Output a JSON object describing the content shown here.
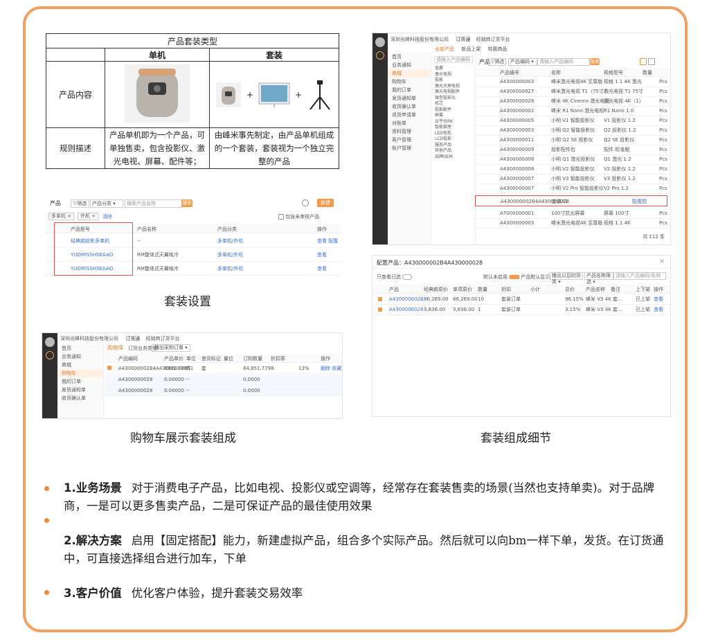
{
  "table": {
    "title": "产品套装类型",
    "col_single": "单机",
    "col_bundle": "套装",
    "row_content": "产品内容",
    "row_rule": "规则描述",
    "rule_single": "产品单机即为一个产品，可单独售卖，包含投影仪、激光电视、屏幕、配件等；",
    "rule_bundle": "由峰米事先制定，由产品单机组成的一个套装，套装视为一个独立完整的产品",
    "plus": "+"
  },
  "suite_setting": {
    "caption": "套装设置",
    "title": "产品",
    "filter": "筛选",
    "select": "产品分类",
    "search_placeholder": "搜索产品名称",
    "search_btn": "搜索",
    "create_btn": "新建",
    "tag_single": "多单机",
    "tag_outer": "外机",
    "clear": "清除",
    "check_label": "包含未审核产品",
    "headers": [
      "产品型号",
      "产品名称",
      "产品分类",
      "操作"
    ],
    "rows": [
      {
        "model": "经典款投影多单机",
        "name": "--",
        "category": "多单机/外机",
        "op": "查看 配置"
      },
      {
        "model": "YUOMISSH5EAAO",
        "name": "RM整体式天翼格冷",
        "category": "多单机/外机",
        "op": "查看"
      },
      {
        "model": "YUOMISSH5EAAO",
        "name": "RM整体式天翼格冷",
        "category": "多单机/外机",
        "op": "查看"
      }
    ]
  },
  "cart_shot": {
    "caption": "购物车展示套装组成",
    "company": "深圳光峰科技股份有限公司",
    "tab_order": "订货通",
    "tab_platform": "经销商订货平台",
    "cart_tab": "购物车",
    "type_tab": "订货业务类型",
    "select": "播出采购订单",
    "menu": [
      "首页",
      "业务通知",
      "商城",
      "购物车",
      "我的订单",
      "发货通知单",
      "收货确认单"
    ],
    "headers": [
      "产品编码",
      "产品单价",
      "单位",
      "查货标记",
      "量位",
      "订购数量",
      "折扣率",
      "操作"
    ],
    "rows": [
      {
        "code": "A430000002B4A430000028",
        "price": "8901.78951",
        "unit": "件",
        "flag": "套",
        "amt": "84,851.7798",
        "pct": "13%",
        "op": "删除 收藏"
      },
      {
        "code": "A4300000028",
        "price": "0.00000",
        "unit": "--",
        "flag": "",
        "amt": "0.0000",
        "pct": "",
        "op": ""
      },
      {
        "code": "A4300000028",
        "price": "0.00000",
        "unit": "--",
        "flag": "",
        "amt": "0.0000",
        "pct": "",
        "op": ""
      }
    ]
  },
  "mall_shot": {
    "company": "深圳光峰科技股份有限公司",
    "tab_order": "订货通",
    "tab_platform": "经销商订货平台",
    "tabs": [
      "全部产品",
      "新品上架",
      "特惠商品"
    ],
    "title": "产品",
    "filter": "筛选",
    "select": "产品编码",
    "search_placeholder": "请输入产品编码",
    "search_btn": "搜索",
    "menu": [
      "首页",
      "业务通知",
      "商城",
      "购物车",
      "我的订单",
      "发货通知单",
      "收货确认单",
      "退货申请单",
      "对账单",
      "资料管理",
      "客户管理",
      "账户管理"
    ],
    "categories": [
      "全部",
      "激光电视",
      "投影",
      "激光大屏电视",
      "激光电视配件",
      "微型投影仪",
      "机芯",
      "投影配件",
      "屏幕",
      "云平台RK",
      "智能家居",
      "LED电视",
      "LCD投影",
      "服务产品",
      "其他产品",
      "品牌OEM"
    ],
    "headers": [
      "产品编号",
      "名称",
      "规格型号",
      "数量"
    ],
    "rows": [
      {
        "code": "A4300000003",
        "name": "峰米激光电视4K 至尊版",
        "spec": "规格 1.1 4K 激光",
        "unit": "Pcs"
      },
      {
        "code": "A4300000027",
        "name": "峰米激光电视 T1（75寸）",
        "spec": "激光电视 T1 75寸",
        "unit": "Pcs"
      },
      {
        "code": "A4300000028",
        "name": "峰米 4K Cinema 激光电视",
        "spec": "激光电视 4K（1）",
        "unit": "Pcs"
      },
      {
        "code": "A4300000002",
        "name": "峰米 R1 Nano 激光电视",
        "spec": "R1 Nano 1.0",
        "unit": "Pcs"
      },
      {
        "code": "A4300000005",
        "name": "小明 V1 智能投影仪",
        "spec": "V1 投影仪 1.2",
        "unit": "Pcs"
      },
      {
        "code": "A4300000003",
        "name": "小明 Q2 智能投影仪",
        "spec": "Q2 投影仪 1.2",
        "unit": "Pcs"
      },
      {
        "code": "A4300000011",
        "name": "小明 Q2 SE 投影仪",
        "spec": "Q2 SE 投影仪",
        "unit": "Pcs"
      },
      {
        "code": "A4300000009",
        "name": "投影配件包",
        "spec": "配件 标准版",
        "unit": "Pcs"
      },
      {
        "code": "A4300000006",
        "name": "小明 Q1 激光投影仪",
        "spec": "Q1 激光 1.2",
        "unit": "Pcs"
      },
      {
        "code": "A4300000008",
        "name": "小明 V2 智能投影仪",
        "spec": "V2 投影仪 1.2",
        "unit": "Pcs"
      },
      {
        "code": "A4300000007",
        "name": "小明 V3 智能投影仪",
        "spec": "V3 投影仪 1.2",
        "unit": "Pcs"
      },
      {
        "code": "A4300000007",
        "name": "小明 V2 Pro 智能投影仪",
        "spec": "V2 Pro 1.2",
        "unit": "Pcs"
      }
    ],
    "highlight": {
      "code": "A430000002B4A430000028",
      "name": "套装A1",
      "link": "配置图"
    },
    "after_rows": [
      {
        "code": "A7000000001",
        "name": "100寸抗光屏幕",
        "spec": "屏幕 100寸",
        "unit": "Pcs"
      },
      {
        "code": "A4300000003",
        "name": "峰米激光电视4K 至尊版",
        "spec": "规格 1.1 4K",
        "unit": "Pcs"
      }
    ],
    "pagination": "共 112 条"
  },
  "detail_shot": {
    "caption": "套装组成细节",
    "title": "配置产品：A430000002B4A430000028",
    "close": "×",
    "left_label": "只查看已选",
    "toggle1": "默认未启用",
    "toggle2": "产品默认显示",
    "select1": "播出以后的货类",
    "select2": "产品名称筛选",
    "search_placeholder": "请输入产品编码/名称",
    "headers": [
      "产品",
      "经典款原价",
      "单项原价",
      "数量",
      "折扣",
      "小计",
      "总价",
      "产品名称",
      "备注",
      "上下架",
      "操作"
    ],
    "rows": [
      {
        "code": "A430000002B",
        "v1": "86,269.00",
        "v2": "86,269.00",
        "qty": "10",
        "type": "套装订单",
        "pct": "96.15%",
        "name": "峰米 V3 4K 套...",
        "shelf": "已上架",
        "op": "查看"
      },
      {
        "code": "A4300000028",
        "v1": "3,636.00",
        "v2": "3,636.00",
        "qty": "1",
        "type": "套装订单",
        "pct": "3.15%",
        "name": "峰米 V3 4K 套...",
        "shelf": "已上架",
        "op": "查看"
      }
    ]
  },
  "bullets": [
    {
      "title": "1.业务场景",
      "text": "对于消费电子产品，比如电视、投影仪或空调等，经常存在套装售卖的场景(当然也支持单卖)。对于品牌商，一是可以更多售卖产品，二是可保证产品的最佳使用效果"
    },
    {
      "title": "2.解决方案",
      "text": "启用【固定搭配】能力，新建虚拟产品，组合多个实际产品。然后就可以向bm一样下单，发货。在订货通中，可直接选择组合进行加车，下单"
    },
    {
      "title": "3.客户价值",
      "text": "优化客户体验，提升套装交易效率"
    }
  ],
  "colors": {
    "accent": "#f08a3a",
    "frame": "#f0a060",
    "link": "#3a6fd8",
    "highlight": "#e05252"
  }
}
